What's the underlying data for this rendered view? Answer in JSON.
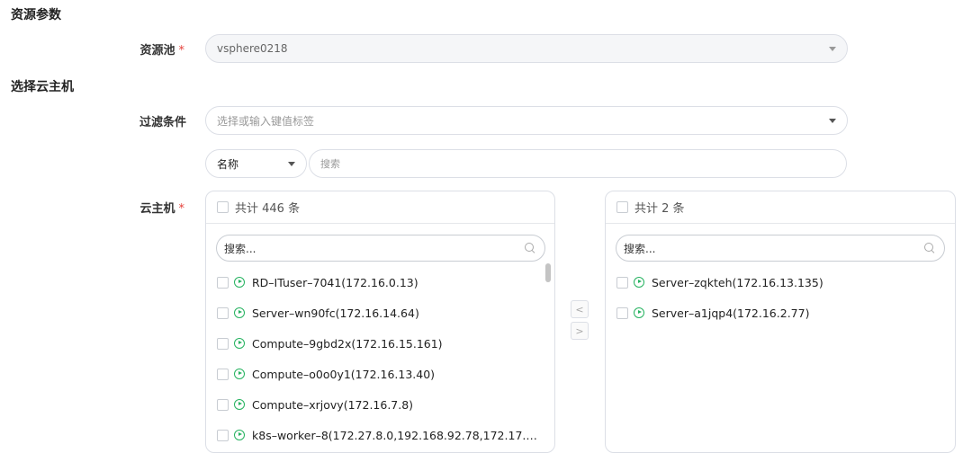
{
  "sections": {
    "resource_params": "资源参数",
    "select_vm": "选择云主机"
  },
  "resource_pool": {
    "label": "资源池",
    "required_mark": "*",
    "value": "vsphere0218"
  },
  "filter": {
    "label": "过滤条件",
    "placeholder": "选择或输入键值标签",
    "field_select": "名称",
    "search_placeholder": "搜索"
  },
  "vm": {
    "label": "云主机",
    "required_mark": "*"
  },
  "source_panel": {
    "total_text": "共计 446 条",
    "search_placeholder": "搜索...",
    "items": [
      {
        "label": "RD–ITuser–7041(172.16.0.13)"
      },
      {
        "label": "Server–wn90fc(172.16.14.64)"
      },
      {
        "label": "Compute–9gbd2x(172.16.15.161)"
      },
      {
        "label": "Compute–o0o0y1(172.16.13.40)"
      },
      {
        "label": "Compute–xrjovy(172.16.7.8)"
      },
      {
        "label": "k8s–worker–8(172.27.8.0,192.168.92.78,172.17.…"
      }
    ]
  },
  "target_panel": {
    "total_text": "共计 2 条",
    "search_placeholder": "搜索...",
    "items": [
      {
        "label": "Server–zqkteh(172.16.13.135)"
      },
      {
        "label": "Server–a1jqp4(172.16.2.77)"
      }
    ]
  },
  "transfer": {
    "left_label": "<",
    "right_label": ">"
  },
  "colors": {
    "required": "#e5413b",
    "running_icon": "#25b25f",
    "border": "#dcdfe6"
  }
}
